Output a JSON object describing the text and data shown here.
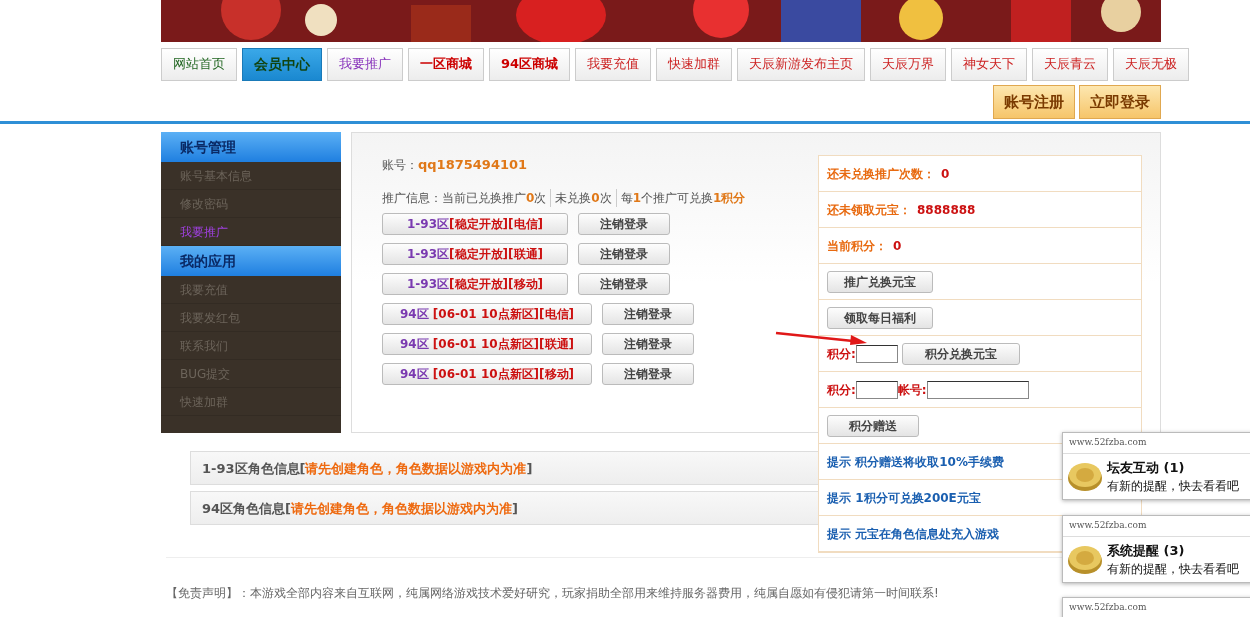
{
  "banner": {
    "kind": "picture"
  },
  "nav": {
    "tabs": [
      {
        "label": "网站首页",
        "kind": "home",
        "selected": false
      },
      {
        "label": "会员中心",
        "kind": "home",
        "selected": true
      },
      {
        "label": "我要推广",
        "kind": "promo",
        "selected": false
      },
      {
        "label": "一区商城",
        "kind": "shop",
        "selected": false
      },
      {
        "label": "94区商城",
        "kind": "shop",
        "selected": false
      },
      {
        "label": "我要充值",
        "kind": "link",
        "selected": false
      },
      {
        "label": "快速加群",
        "kind": "link",
        "selected": false
      },
      {
        "label": "天辰新游发布主页",
        "kind": "link",
        "selected": false
      },
      {
        "label": "天辰万界",
        "kind": "link",
        "selected": false
      },
      {
        "label": "神女天下",
        "kind": "link",
        "selected": false
      },
      {
        "label": "天辰青云",
        "kind": "link",
        "selected": false
      },
      {
        "label": "天辰无极",
        "kind": "link",
        "selected": false
      }
    ]
  },
  "header_buttons": [
    "账号注册",
    "立即登录"
  ],
  "sidebar": [
    {
      "title": "账号管理",
      "items": [
        {
          "label": "账号基本信息",
          "selected": false
        },
        {
          "label": "修改密码",
          "selected": false
        },
        {
          "label": "我要推广",
          "selected": true
        }
      ]
    },
    {
      "title": "我的应用",
      "items": [
        {
          "label": "我要充值",
          "selected": false
        },
        {
          "label": "我要发红包",
          "selected": false
        },
        {
          "label": "联系我们",
          "selected": false
        },
        {
          "label": "BUG提交",
          "selected": false
        },
        {
          "label": "快速加群",
          "selected": false
        }
      ]
    }
  ],
  "account": {
    "label": "账号：",
    "value": "qq1875494101"
  },
  "promo": {
    "label": "推广信息：",
    "parts": [
      "当前已兑换推广**0**次",
      "未兑换**0**次",
      "每**1**个推广可兑换**1积分**"
    ]
  },
  "servers": [
    {
      "zone": "1-93区",
      "desc": "[稳定开放][电信]",
      "logout": "注销登录"
    },
    {
      "zone": "1-93区",
      "desc": "[稳定开放][联通]",
      "logout": "注销登录"
    },
    {
      "zone": "1-93区",
      "desc": "[稳定开放][移动]",
      "logout": "注销登录"
    },
    {
      "zone": "94区",
      "desc": " [06-01 10点新区][电信]",
      "logout": "注销登录"
    },
    {
      "zone": "94区",
      "desc": " [06-01 10点新区][联通]",
      "logout": "注销登录"
    },
    {
      "zone": "94区",
      "desc": " [06-01 10点新区][移动]",
      "logout": "注销登录"
    }
  ],
  "side_rows": [
    {
      "kind": "stat",
      "label": "还未兑换推广次数：",
      "value": "0"
    },
    {
      "kind": "stat",
      "label": "还未领取元宝：",
      "value": "8888888"
    },
    {
      "kind": "stat",
      "label": "当前积分：",
      "value": "0"
    },
    {
      "kind": "button",
      "label": "推广兑换元宝"
    },
    {
      "kind": "button",
      "label": "领取每日福利"
    },
    {
      "kind": "exchange",
      "label": "积分:",
      "button": "积分兑换元宝"
    },
    {
      "kind": "transfer",
      "label": "积分:",
      "label2": "帐号:"
    },
    {
      "kind": "button",
      "label": "积分赠送"
    },
    {
      "kind": "tip",
      "label": "提示 积分赠送将收取10%手续费"
    },
    {
      "kind": "tip",
      "label": "提示 1积分可兑换200E元宝"
    },
    {
      "kind": "tip",
      "label": "提示 元宝在角色信息处充入游戏"
    }
  ],
  "char_rows": [
    {
      "title": "1-93区角色信息[",
      "note": "请先创建角色，角色数据以游戏内为准",
      "close": "]"
    },
    {
      "title": "94区角色信息[",
      "note": "请先创建角色，角色数据以游戏内为准",
      "close": "]"
    }
  ],
  "disclaimer": "【免责声明】：本游戏全部内容来自互联网，纯属网络游戏技术爱好研究，玩家捐助全部用来维持服务器费用，纯属自愿如有侵犯请第一时间联系!",
  "notifications": [
    {
      "source": "www.52fzba.com",
      "title": "坛友互动",
      "count": "(1)",
      "message": "有新的提醒，快去看看吧"
    },
    {
      "source": "www.52fzba.com",
      "title": "系统提醒",
      "count": "(3)",
      "message": "有新的提醒，快去看看吧"
    },
    {
      "source": "www.52fzba.com"
    }
  ]
}
